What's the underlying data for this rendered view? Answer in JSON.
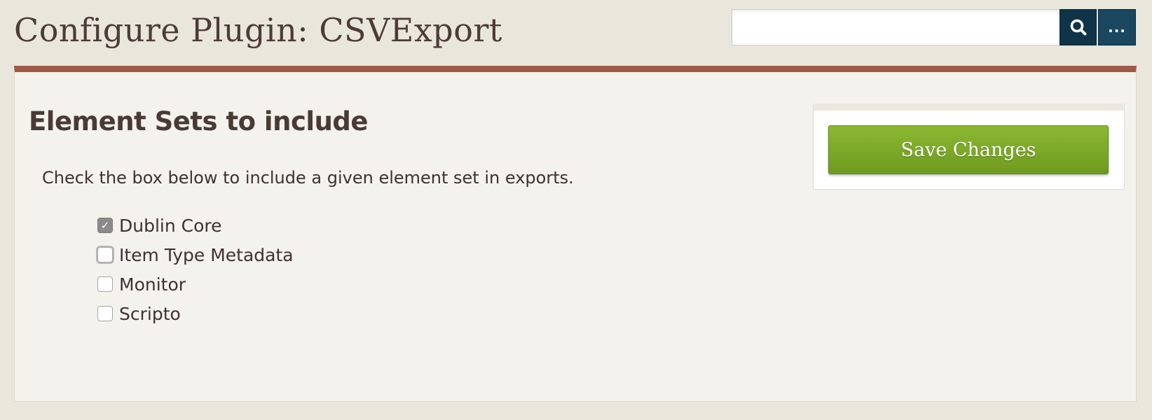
{
  "header": {
    "title": "Configure Plugin: CSVExport"
  },
  "search": {
    "value": "",
    "placeholder": "",
    "search_icon": "search-icon",
    "more_label": "..."
  },
  "main": {
    "heading": "Element Sets to include",
    "explanation": "Check the box below to include a given element set in exports.",
    "element_sets": [
      {
        "label": "Dublin Core",
        "checked": true
      },
      {
        "label": "Item Type Metadata",
        "checked": false
      },
      {
        "label": "Monitor",
        "checked": false
      },
      {
        "label": "Scripto",
        "checked": false
      }
    ]
  },
  "save_panel": {
    "save_label": "Save Changes"
  },
  "colors": {
    "background": "#e9e6dc",
    "panel_top_border": "#9e5a47",
    "search_button": "#0f3447",
    "save_button": "#7aa628",
    "text": "#4a3a36"
  }
}
